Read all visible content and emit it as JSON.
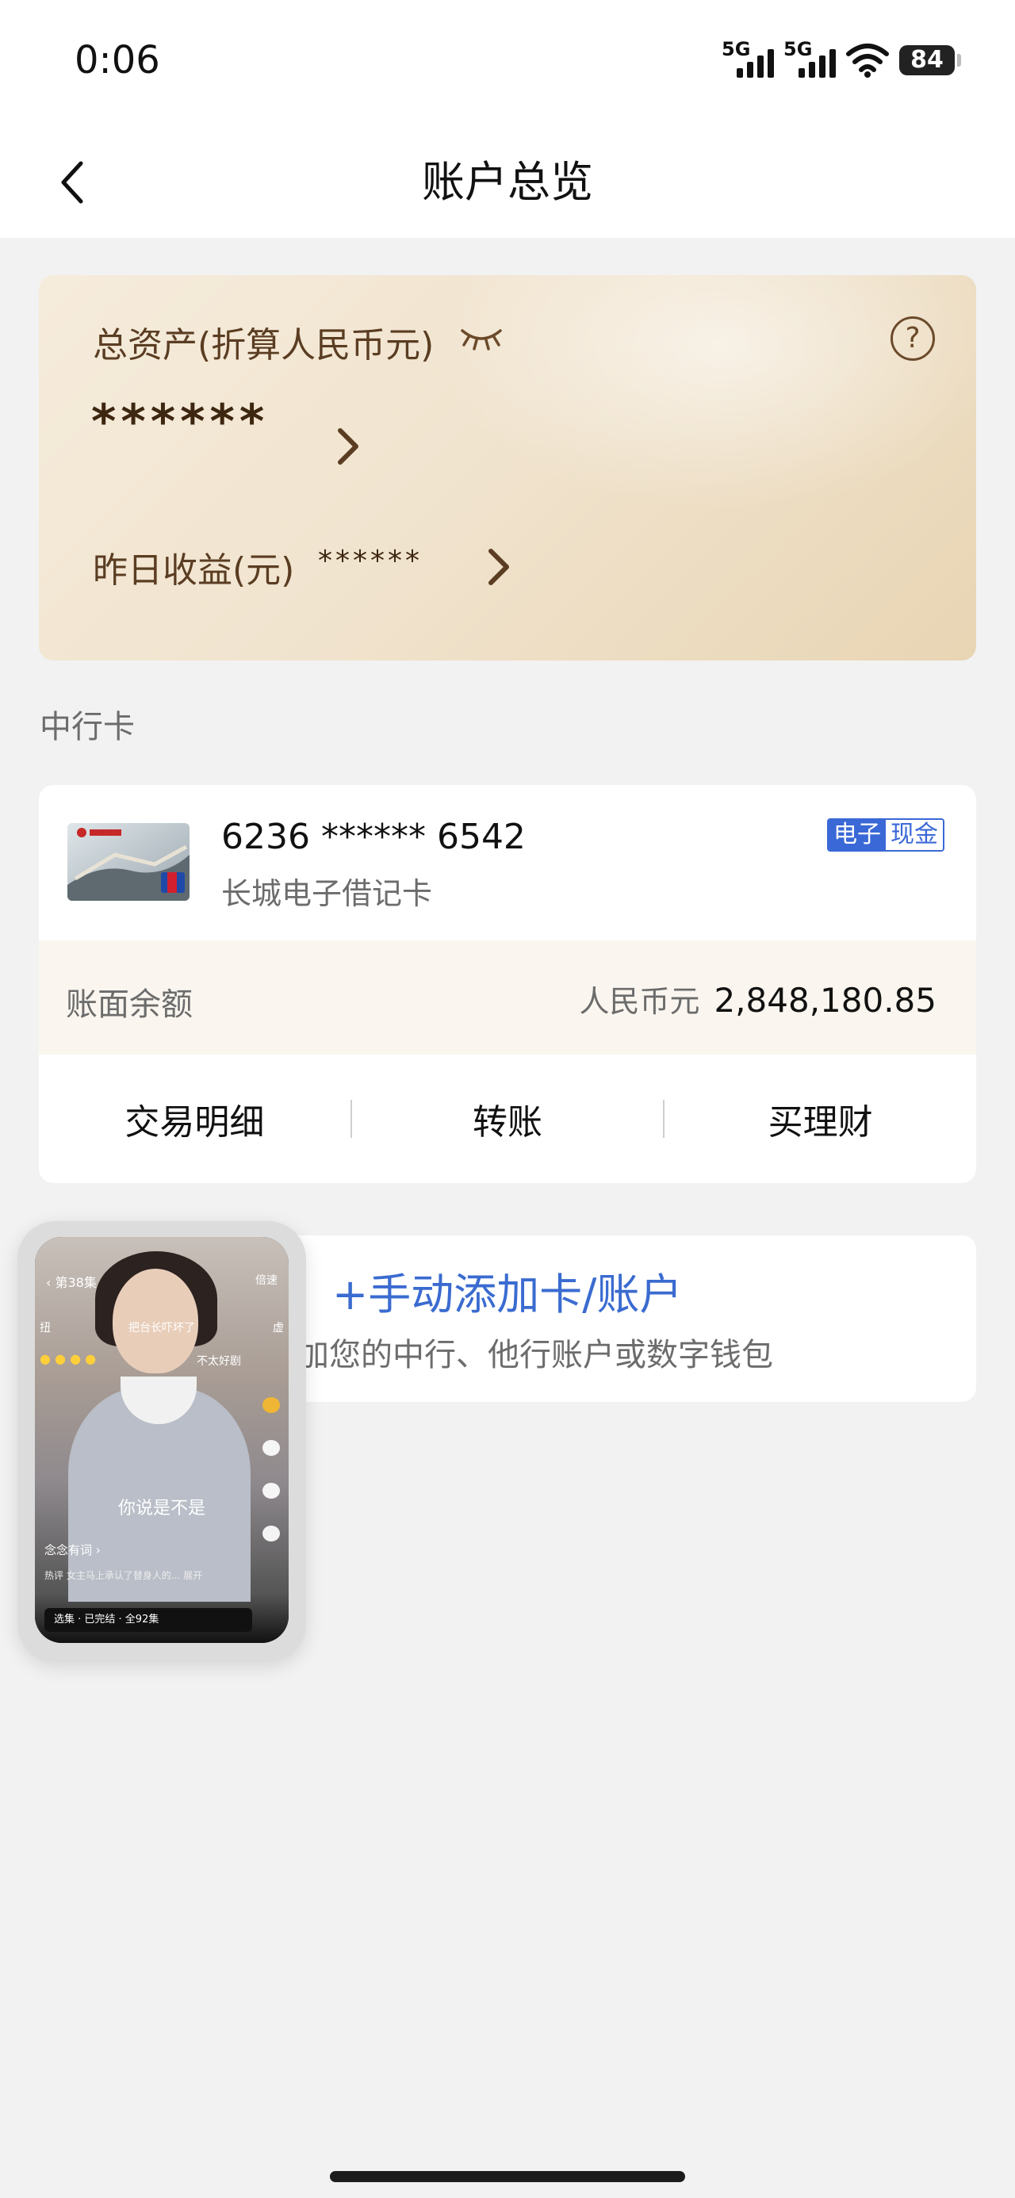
{
  "status_bar": {
    "time": "0:06",
    "signal_1": "5G",
    "signal_2": "5G",
    "battery": "84",
    "icons": [
      "signal-icon",
      "wifi-icon",
      "battery-icon"
    ]
  },
  "header": {
    "title": "账户总览",
    "back_icon": "chevron-left-icon"
  },
  "asset_card": {
    "total_label": "总资产(折算人民币元)",
    "total_value": "******",
    "yesterday_label": "昨日收益(元)",
    "yesterday_value": "******",
    "help_symbol": "?",
    "icons": [
      "eye-closed-icon",
      "help-icon",
      "chevron-right-icon"
    ]
  },
  "section": {
    "title": "中行卡"
  },
  "bank_card": {
    "number": "6236 ****** 6542",
    "name": "长城电子借记卡",
    "badge_left": "电子",
    "badge_right": "现金",
    "balance_label": "账面余额",
    "currency": "人民币元",
    "balance": "2,848,180.85",
    "actions": [
      "交易明细",
      "转账",
      "买理财"
    ]
  },
  "add_card": {
    "title": "+手动添加卡/账户",
    "subtitle": "加您的中行、他行账户或数字钱包"
  },
  "pip_video": {
    "episode": "第38集",
    "top_right": "倍速",
    "row_left": "扭",
    "row_mid": "把台长吓坏了",
    "row_right": "虚",
    "tag": "不太好剧",
    "subtitle": "你说是不是",
    "author": "念念有词 ›",
    "comment": "热评  女主马上承认了替身人的...  展开",
    "bottom_bar": "选集 · 已完结 · 全92集"
  },
  "colors": {
    "accent_blue": "#3a68d6",
    "asset_brown": "#5a3d22",
    "card_gold": "#f1e4cf"
  }
}
